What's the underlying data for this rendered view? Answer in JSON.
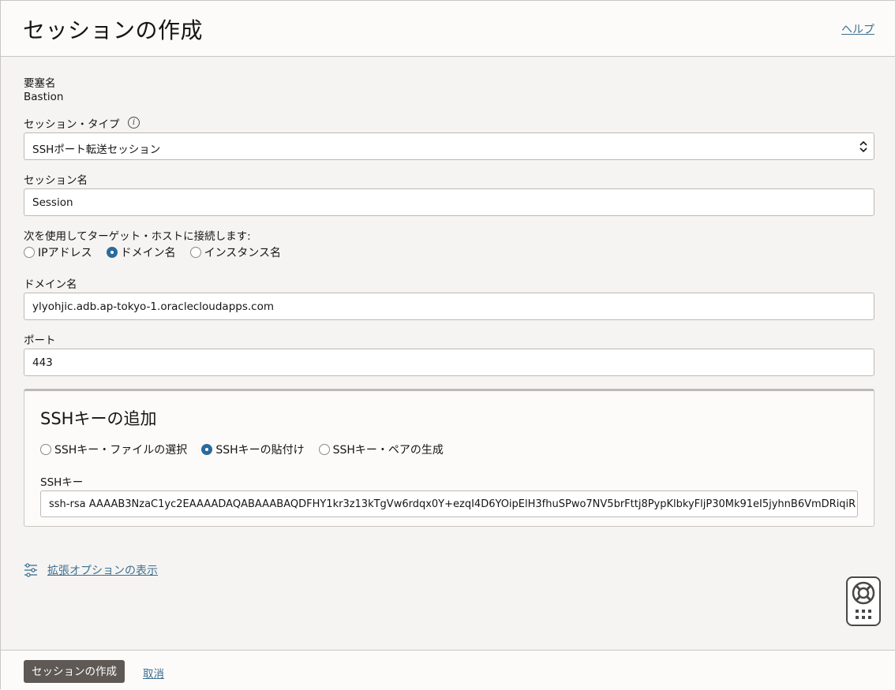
{
  "header": {
    "title": "セッションの作成",
    "help_label": "ヘルプ"
  },
  "bastion": {
    "label": "要塞名",
    "value": "Bastion"
  },
  "session_type": {
    "label": "セッション・タイプ",
    "info_icon": "info-icon",
    "selected": "SSHポート転送セッション"
  },
  "session_name": {
    "label": "セッション名",
    "value": "Session"
  },
  "connect_by": {
    "label": "次を使用してターゲット・ホストに接続します:",
    "options": [
      {
        "label": "IPアドレス",
        "checked": false
      },
      {
        "label": "ドメイン名",
        "checked": true
      },
      {
        "label": "インスタンス名",
        "checked": false
      }
    ]
  },
  "domain": {
    "label": "ドメイン名",
    "value": "ylyohjic.adb.ap-tokyo-1.oraclecloudapps.com"
  },
  "port": {
    "label": "ポート",
    "value": "443"
  },
  "ssh_card": {
    "title": "SSHキーの追加",
    "options": [
      {
        "label": "SSHキー・ファイルの選択",
        "checked": false
      },
      {
        "label": "SSHキーの貼付け",
        "checked": true
      },
      {
        "label": "SSHキー・ペアの生成",
        "checked": false
      }
    ],
    "key_label": "SSHキー",
    "key_value": "ssh-rsa AAAAB3NzaC1yc2EAAAADAQABAAABAQDFHY1kr3z13kTgVw6rdqx0Y+ezqI4D6YOipElH3fhuSPwo7NV5brFttj8PypKlbkyFljP30Mk91eI5jyhnB6VmDRiqiR"
  },
  "advanced": {
    "icon": "sliders-icon",
    "label": "拡張オプションの表示"
  },
  "help_widget": {
    "icon": "lifebuoy-icon"
  },
  "footer": {
    "create_label": "セッションの作成",
    "cancel_label": "取消"
  },
  "colors": {
    "accent": "#2c6a9a",
    "link": "#3e6f8f",
    "primary_button": "#5f5955"
  }
}
